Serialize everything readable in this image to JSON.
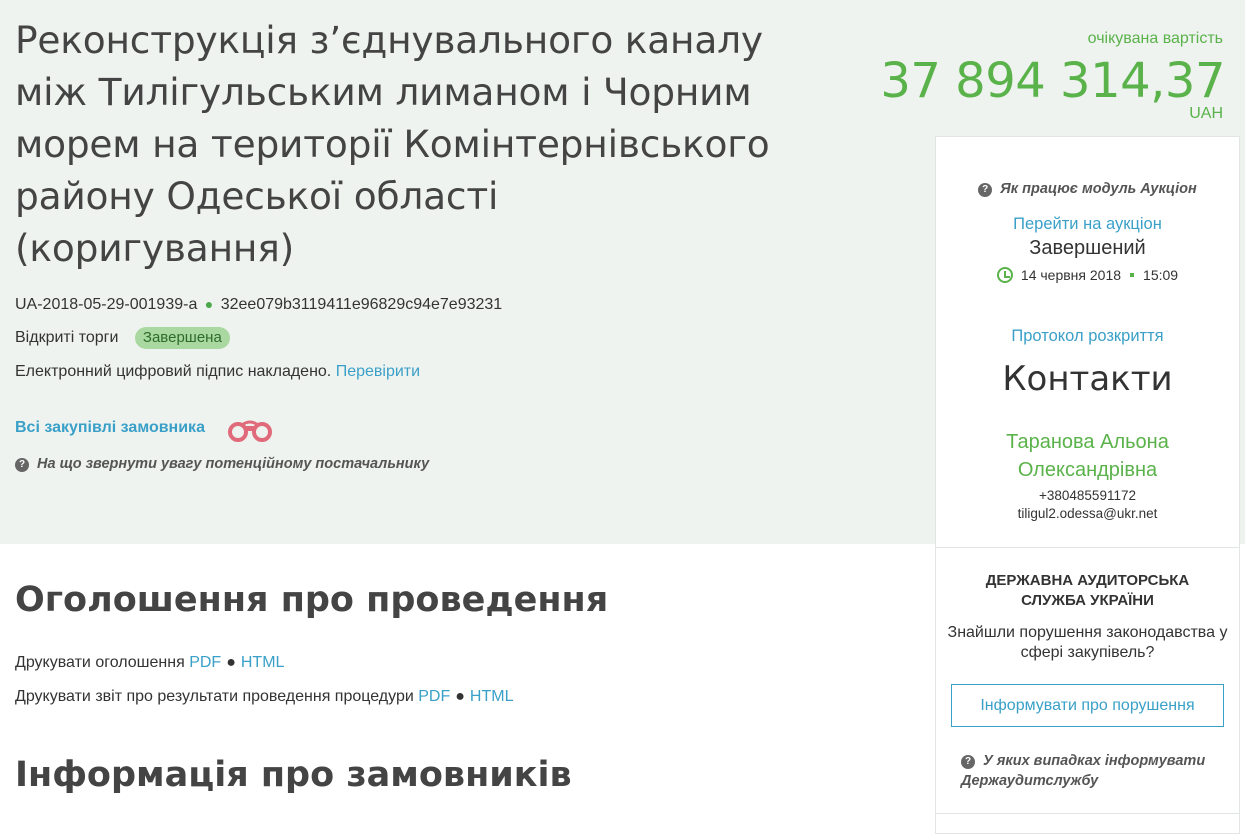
{
  "tender": {
    "title": "Реконструкція з’єднувального каналу між Тилігульським лиманом і Чорним морем на території Комінтернівського району Одеської області (коригування)",
    "id": "UA-2018-05-29-001939-a",
    "hash": "32ee079b3119411e96829c94e7e93231",
    "procedure_type": "Відкриті торги",
    "status": "Завершена",
    "signature_text": "Електронний цифровий підпис накладено.",
    "signature_link": "Перевірити",
    "all_procurements_link": "Всі закупівлі замовника",
    "attention_text": "На що звернути увагу потенційному постачальнику"
  },
  "price": {
    "label": "очікувана вартість",
    "value": "37 894 314,37",
    "currency": "UAH"
  },
  "auction": {
    "help": "Як працює модуль Аукціон",
    "link": "Перейти на аукціон",
    "status": "Завершений",
    "date": "14 червня 2018",
    "time": "15:09",
    "protocol_link": "Протокол розкриття"
  },
  "contacts": {
    "heading": "Контакти",
    "name": "Таранова Альона Олександрівна",
    "phone": "+380485591172",
    "email": "tiligul2.odessa@ukr.net"
  },
  "audit": {
    "title": "ДЕРЖАВНА АУДИТОРСЬКА СЛУЖБА УКРАЇНИ",
    "question": "Знайшли порушення законодавства у сфері закупівель?",
    "button": "Інформувати про порушення",
    "help": "У яких випадках інформувати Держаудитслужбу"
  },
  "sections": {
    "announcement_title": "Оголошення про проведення",
    "print_announcement": "Друкувати оголошення",
    "print_report": "Друкувати звіт про результати проведення процедури",
    "pdf": "PDF",
    "html": "HTML",
    "customers_title": "Інформація про замовників"
  },
  "colors": {
    "accent_green": "#5ab24a",
    "link_blue": "#3aa0c8",
    "hero_bg": "#eff3f0",
    "badge_bg": "#a9d9a0"
  }
}
